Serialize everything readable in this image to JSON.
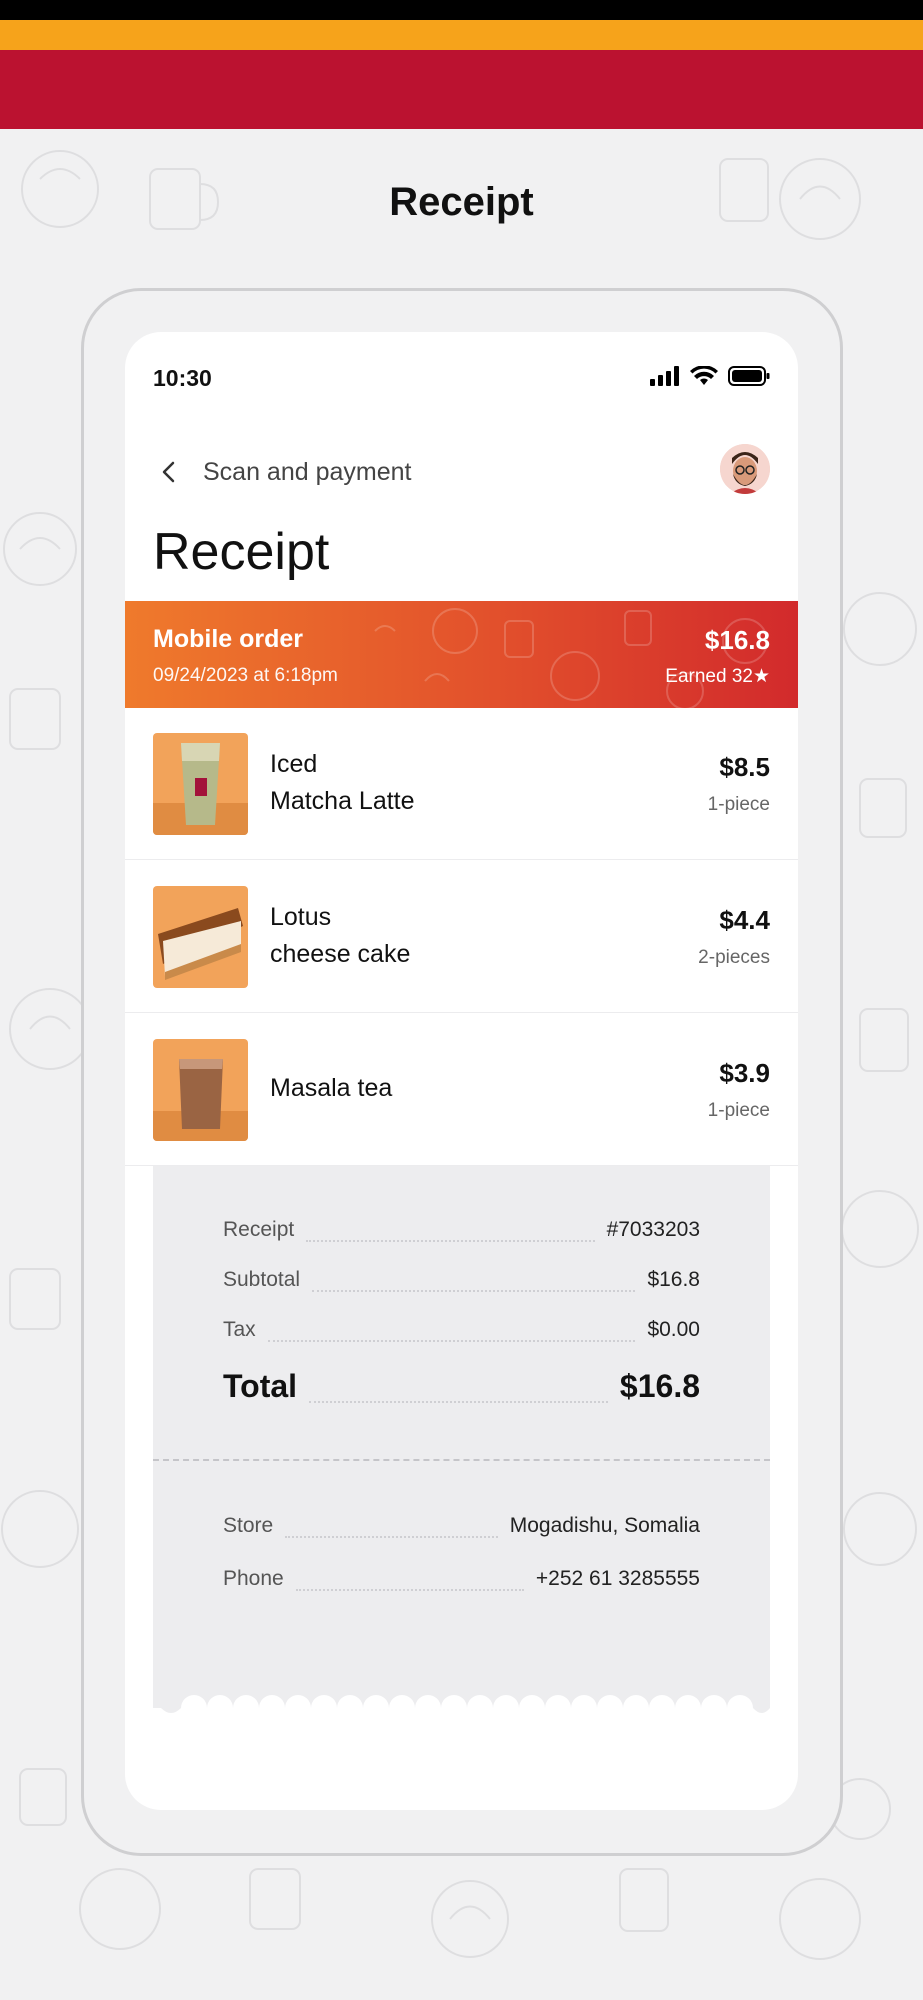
{
  "page": {
    "heading": "Receipt"
  },
  "colors": {
    "brand_red": "#bb1230",
    "accent_orange": "#f6a31b",
    "banner_start": "#ef7a2c",
    "banner_end": "#d22a2c"
  },
  "status_bar": {
    "time": "10:30",
    "icons": [
      "signal-icon",
      "wifi-icon",
      "battery-icon"
    ]
  },
  "nav": {
    "back_label": "Scan and payment",
    "back_icon": "chevron-left-icon",
    "avatar": "avatar"
  },
  "screen_title": "Receipt",
  "order": {
    "label": "Mobile order",
    "date": "09/24/2023 at 6:18pm",
    "total": "$16.8",
    "earned": "Earned  32★"
  },
  "items": [
    {
      "name_line1": "Iced",
      "name_line2": "Matcha Latte",
      "price": "$8.5",
      "qty": "1-piece"
    },
    {
      "name_line1": "Lotus",
      "name_line2": "cheese cake",
      "price": "$4.4",
      "qty": "2-pieces"
    },
    {
      "name_line1": "Masala tea",
      "name_line2": "",
      "price": "$3.9",
      "qty": "1-piece"
    }
  ],
  "summary": {
    "receipt_label": "Receipt",
    "receipt_value": "#7033203",
    "subtotal_label": "Subtotal",
    "subtotal_value": "$16.8",
    "tax_label": "Tax",
    "tax_value": "$0.00",
    "total_label": "Total",
    "total_value": "$16.8",
    "store_label": "Store",
    "store_value": "Mogadishu, Somalia",
    "phone_label": "Phone",
    "phone_value": "+252 61 3285555"
  }
}
